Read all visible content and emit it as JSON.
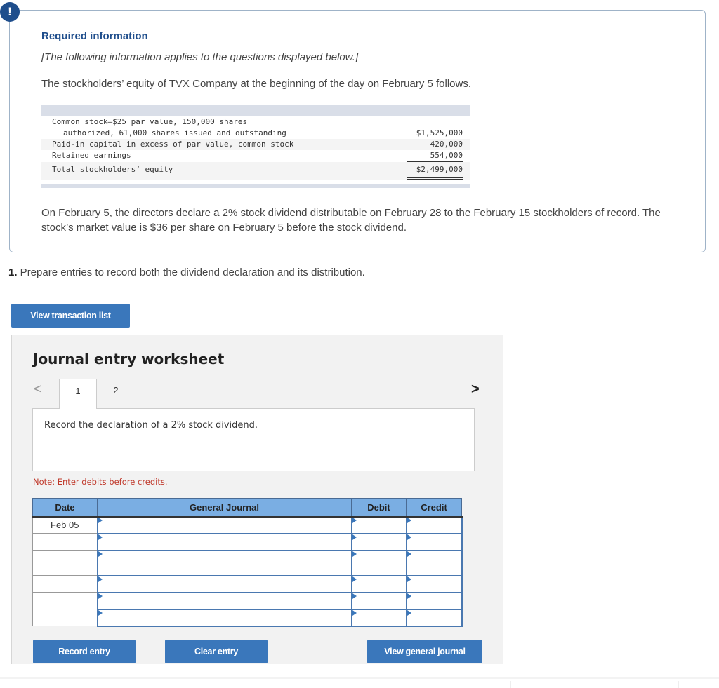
{
  "info": {
    "alert_glyph": "!",
    "title": "Required information",
    "subtitle": "[The following information applies to the questions displayed below.]",
    "intro": "The stockholders’ equity of TVX Company at the beginning of the day on February 5 follows.",
    "equity": {
      "rows": [
        {
          "label_line1": "Common stock—$25 par value, 150,000 shares",
          "label_line2": "authorized, 61,000 shares issued and outstanding",
          "amount": "$1,525,000"
        },
        {
          "label": "Paid-in capital in excess of par value, common stock",
          "amount": "420,000"
        },
        {
          "label": "Retained earnings",
          "amount": "554,000"
        },
        {
          "label": "Total stockholders’ equity",
          "amount": "$2,499,000"
        }
      ]
    },
    "declaration": "On February 5, the directors declare a 2% stock dividend distributable on February 28 to the February 15 stockholders of record. The stock’s market value is $36 per share on February 5 before the stock dividend."
  },
  "question": {
    "number": "1.",
    "text": " Prepare entries to record both the dividend declaration and its distribution."
  },
  "buttons": {
    "view_transaction_list": "View transaction list",
    "record_entry": "Record entry",
    "clear_entry": "Clear entry",
    "view_general_journal": "View general journal"
  },
  "worksheet": {
    "title": "Journal entry worksheet",
    "prev_glyph": "<",
    "next_glyph": ">",
    "tabs": [
      "1",
      "2"
    ],
    "active_tab": "1",
    "description": "Record the declaration of a 2% stock dividend.",
    "note": "Note: Enter debits before credits.",
    "columns": [
      "Date",
      "General Journal",
      "Debit",
      "Credit"
    ],
    "rows": [
      {
        "date": "Feb 05",
        "account": "",
        "debit": "",
        "credit": ""
      },
      {
        "date": "",
        "account": "",
        "debit": "",
        "credit": ""
      },
      {
        "date": "",
        "account": "",
        "debit": "",
        "credit": ""
      },
      {
        "date": "",
        "account": "",
        "debit": "",
        "credit": ""
      },
      {
        "date": "",
        "account": "",
        "debit": "",
        "credit": ""
      },
      {
        "date": "",
        "account": "",
        "debit": "",
        "credit": ""
      }
    ]
  }
}
